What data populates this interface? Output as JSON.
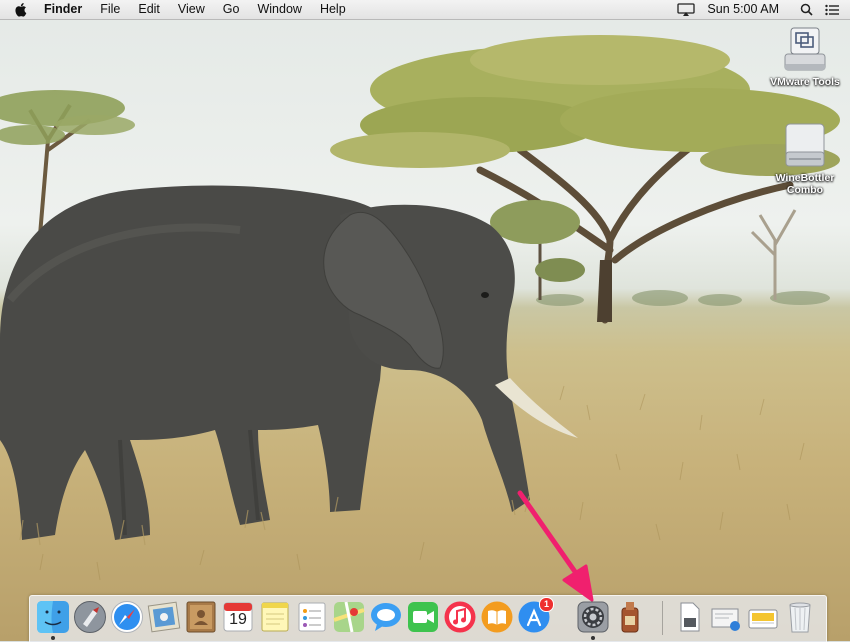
{
  "menubar": {
    "app_name": "Finder",
    "items": [
      "File",
      "Edit",
      "View",
      "Go",
      "Window",
      "Help"
    ],
    "clock": "Sun 5:00 AM",
    "status_icons": [
      "airplay-icon",
      "search-icon",
      "notification-center-icon"
    ]
  },
  "desktop": {
    "icons": [
      {
        "label": "VMware Tools",
        "icon": "vmware-tools-drive-icon"
      },
      {
        "label": "WineBottler Combo",
        "icon": "disk-drive-icon"
      }
    ],
    "wallpaper": "elephant-savanna"
  },
  "dock": {
    "apps": [
      {
        "name": "Finder",
        "icon": "finder-icon",
        "running": true
      },
      {
        "name": "Launchpad",
        "icon": "launchpad-icon"
      },
      {
        "name": "Safari",
        "icon": "safari-icon"
      },
      {
        "name": "Mail",
        "icon": "mail-icon"
      },
      {
        "name": "Contacts",
        "icon": "contacts-icon"
      },
      {
        "name": "Calendar",
        "icon": "calendar-icon",
        "day": "19"
      },
      {
        "name": "Notes",
        "icon": "notes-icon"
      },
      {
        "name": "Reminders",
        "icon": "reminders-icon"
      },
      {
        "name": "Maps",
        "icon": "maps-icon"
      },
      {
        "name": "Messages",
        "icon": "messages-icon"
      },
      {
        "name": "FaceTime",
        "icon": "facetime-icon"
      },
      {
        "name": "iTunes",
        "icon": "itunes-icon"
      },
      {
        "name": "iBooks",
        "icon": "ibooks-icon"
      },
      {
        "name": "App Store",
        "icon": "app-store-icon",
        "badge": "1"
      },
      {
        "name": "System Preferences",
        "icon": "system-preferences-icon",
        "running": true
      },
      {
        "name": "WineBottler",
        "icon": "winebottler-icon"
      }
    ],
    "stacks": [
      {
        "name": "Documents",
        "icon": "documents-stack-icon"
      },
      {
        "name": "Downloads",
        "icon": "downloads-stack-icon"
      },
      {
        "name": "Folder",
        "icon": "folder-stack-icon"
      },
      {
        "name": "Trash",
        "icon": "trash-icon"
      }
    ]
  },
  "annotation": {
    "type": "arrow",
    "color": "#f0206e",
    "points_to": "system-preferences-icon"
  }
}
